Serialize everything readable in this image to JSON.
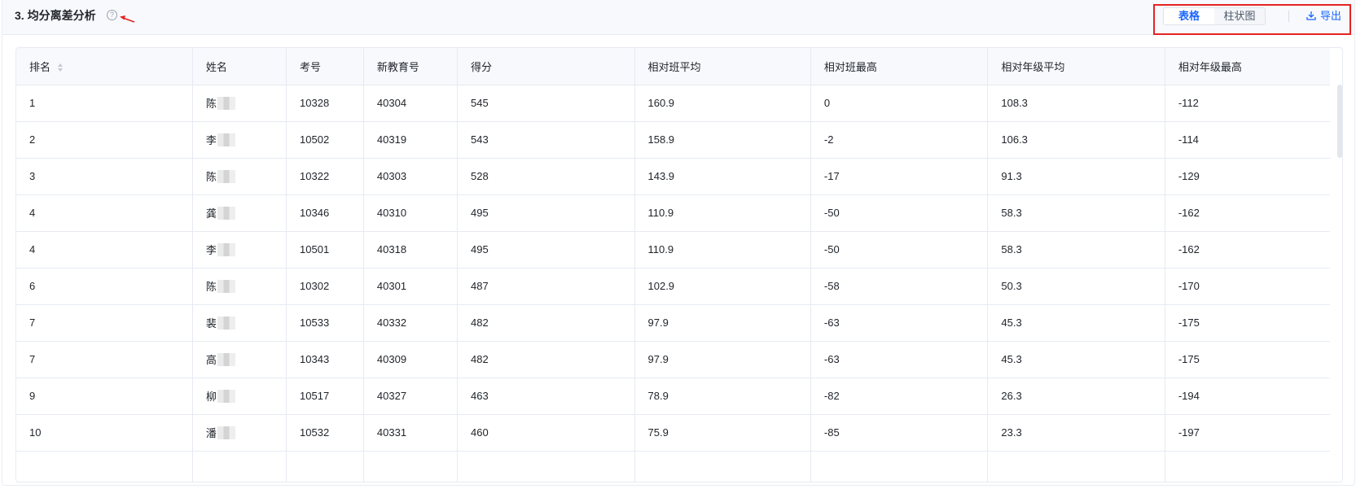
{
  "section": {
    "title": "3. 均分离差分析",
    "help_glyph": "?"
  },
  "view_toggle": {
    "table_label": "表格",
    "chart_label": "柱状图",
    "active": "table"
  },
  "export": {
    "label": "导出"
  },
  "annotation_color": "#e52323",
  "accent_color": "#1a66ff",
  "table": {
    "columns": [
      "排名",
      "姓名",
      "考号",
      "新教育号",
      "得分",
      "相对班平均",
      "相对班最高",
      "相对年级平均",
      "相对年级最高"
    ],
    "rows": [
      {
        "rank": "1",
        "name": "陈",
        "exam_no": "10328",
        "edu_no": "40304",
        "score": "545",
        "rel_class_avg": "160.9",
        "rel_class_max": "0",
        "rel_grade_avg": "108.3",
        "rel_grade_max": "-112"
      },
      {
        "rank": "2",
        "name": "李",
        "exam_no": "10502",
        "edu_no": "40319",
        "score": "543",
        "rel_class_avg": "158.9",
        "rel_class_max": "-2",
        "rel_grade_avg": "106.3",
        "rel_grade_max": "-114"
      },
      {
        "rank": "3",
        "name": "陈",
        "exam_no": "10322",
        "edu_no": "40303",
        "score": "528",
        "rel_class_avg": "143.9",
        "rel_class_max": "-17",
        "rel_grade_avg": "91.3",
        "rel_grade_max": "-129"
      },
      {
        "rank": "4",
        "name": "龚",
        "exam_no": "10346",
        "edu_no": "40310",
        "score": "495",
        "rel_class_avg": "110.9",
        "rel_class_max": "-50",
        "rel_grade_avg": "58.3",
        "rel_grade_max": "-162"
      },
      {
        "rank": "4",
        "name": "李",
        "exam_no": "10501",
        "edu_no": "40318",
        "score": "495",
        "rel_class_avg": "110.9",
        "rel_class_max": "-50",
        "rel_grade_avg": "58.3",
        "rel_grade_max": "-162"
      },
      {
        "rank": "6",
        "name": "陈",
        "exam_no": "10302",
        "edu_no": "40301",
        "score": "487",
        "rel_class_avg": "102.9",
        "rel_class_max": "-58",
        "rel_grade_avg": "50.3",
        "rel_grade_max": "-170"
      },
      {
        "rank": "7",
        "name": "裴",
        "exam_no": "10533",
        "edu_no": "40332",
        "score": "482",
        "rel_class_avg": "97.9",
        "rel_class_max": "-63",
        "rel_grade_avg": "45.3",
        "rel_grade_max": "-175"
      },
      {
        "rank": "7",
        "name": "高",
        "exam_no": "10343",
        "edu_no": "40309",
        "score": "482",
        "rel_class_avg": "97.9",
        "rel_class_max": "-63",
        "rel_grade_avg": "45.3",
        "rel_grade_max": "-175"
      },
      {
        "rank": "9",
        "name": "柳",
        "exam_no": "10517",
        "edu_no": "40327",
        "score": "463",
        "rel_class_avg": "78.9",
        "rel_class_max": "-82",
        "rel_grade_avg": "26.3",
        "rel_grade_max": "-194"
      },
      {
        "rank": "10",
        "name": "潘",
        "exam_no": "10532",
        "edu_no": "40331",
        "score": "460",
        "rel_class_avg": "75.9",
        "rel_class_max": "-85",
        "rel_grade_avg": "23.3",
        "rel_grade_max": "-197"
      }
    ]
  }
}
